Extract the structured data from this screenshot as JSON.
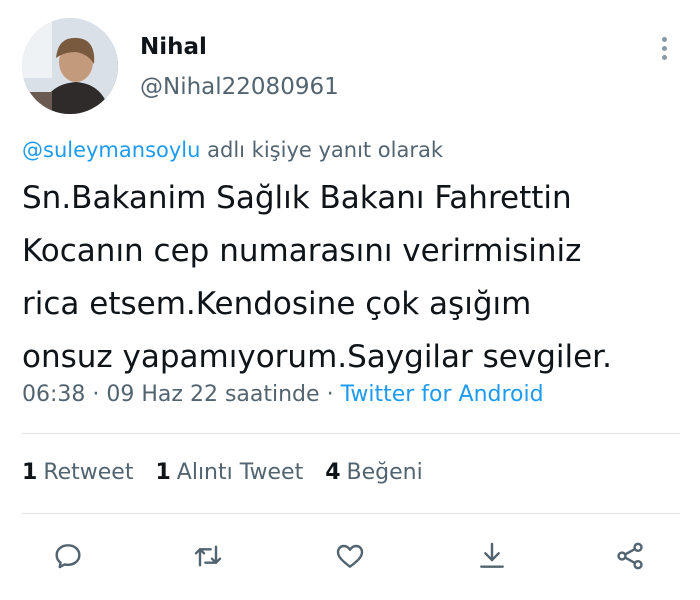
{
  "tweet": {
    "author": {
      "name": "Nihal",
      "handle": "@Nihal22080961"
    },
    "reply_to": {
      "mention": "@suleymansoylu",
      "suffix": "adlı kişiye yanıt olarak"
    },
    "text_lines": [
      "Sn.Bakanim Sağlık Bakanı Fahrettin",
      "Kocanın cep numarasını verirmisiniz",
      "rica etsem.Kendosine çok aşığım",
      "onsuz yapamıyorum.Saygilar sevgiler."
    ],
    "time": "06:38",
    "separator": "·",
    "date": "09 Haz 22 saatinde",
    "source": "Twitter for Android",
    "stats": [
      {
        "count": "1",
        "label": "Retweet"
      },
      {
        "count": "1",
        "label": "Alıntı Tweet"
      },
      {
        "count": "4",
        "label": "Beğeni"
      }
    ]
  },
  "actions": [
    {
      "icon": "reply-icon"
    },
    {
      "icon": "retweet-icon"
    },
    {
      "icon": "like-icon"
    },
    {
      "icon": "download-icon"
    },
    {
      "icon": "share-icon"
    }
  ],
  "colors": {
    "link": "#1d9bf0",
    "muted": "#536471",
    "text": "#0f1419",
    "icon": "#536471"
  }
}
